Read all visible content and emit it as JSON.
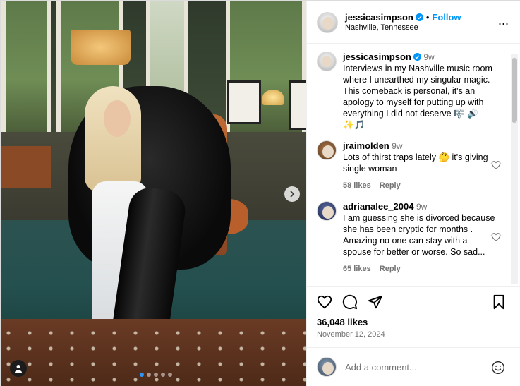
{
  "header": {
    "username": "jessicasimpson",
    "follow_label": "Follow",
    "location": "Nashville, Tennessee",
    "more_label": "..."
  },
  "caption": {
    "username": "jessicasimpson",
    "time": "9w",
    "text": "Interviews in my Nashville music room where I unearthed my singular magic. This comeback is personal, it's an apology to myself for putting up with everything I did not deserve 🎼 🔊 ✨🎵"
  },
  "comments": [
    {
      "username": "jraimolden",
      "time": "9w",
      "text": "Lots of thirst traps lately 🤔 it's giving single woman",
      "likes": "58 likes",
      "reply_label": "Reply"
    },
    {
      "username": "adrianalee_2004",
      "time": "9w",
      "text": "I am guessing she is divorced because she has been cryptic for months . Amazing no one can stay with a spouse for better or worse. So sad...",
      "likes": "65 likes",
      "reply_label": "Reply"
    }
  ],
  "post": {
    "likes": "36,048 likes",
    "date": "November 12, 2024"
  },
  "add_comment": {
    "placeholder": "Add a comment..."
  },
  "colors": {
    "accent": "#0095f6",
    "muted": "#737373",
    "border": "#efefef"
  },
  "icons": [
    "heart-icon",
    "comment-icon",
    "share-icon",
    "bookmark-icon",
    "emoji-icon",
    "chevron-right-icon",
    "user-tag-icon",
    "verified-icon",
    "more-icon"
  ]
}
